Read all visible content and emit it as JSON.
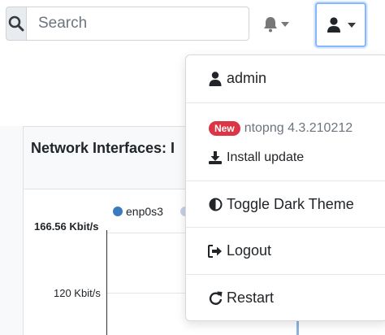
{
  "search": {
    "placeholder": "Search"
  },
  "panel": {
    "title": "Network Interfaces: I",
    "legend": [
      "enp0s3"
    ],
    "y_ticks": [
      "166.56 Kbit/s",
      "120 Kbit/s"
    ]
  },
  "user_menu": {
    "username": "admin",
    "badge": "New",
    "version": "ntopng 4.3.210212",
    "install_update": "Install update",
    "toggle_theme": "Toggle Dark Theme",
    "logout": "Logout",
    "restart": "Restart"
  },
  "colors": {
    "accent": "#86b7fe",
    "badge": "#dc3545",
    "series": "#3a7bbf"
  },
  "icons": [
    "search-icon",
    "bell-icon",
    "user-icon",
    "download-icon",
    "half-circle-icon",
    "sign-out-icon",
    "redo-icon"
  ]
}
